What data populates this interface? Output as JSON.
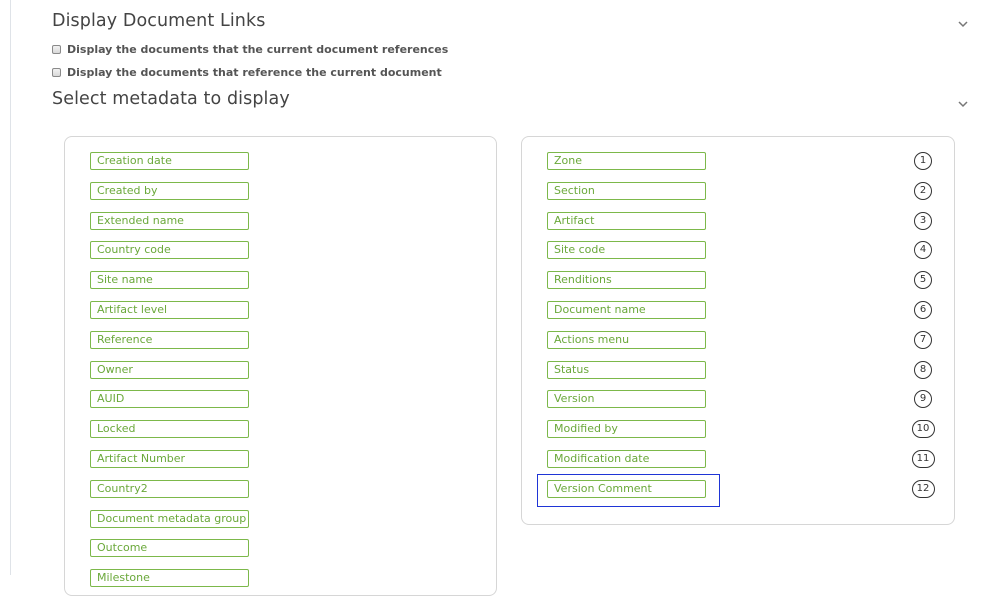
{
  "sections": {
    "links_title": "Display Document Links",
    "metadata_title": "Select metadata to display"
  },
  "checkboxes": [
    {
      "label": "Display the documents that the current document references",
      "checked": false
    },
    {
      "label": "Display the documents that reference the current document",
      "checked": false
    }
  ],
  "available_fields": [
    "Creation date",
    "Created by",
    "Extended name",
    "Country code",
    "Site name",
    "Artifact level",
    "Reference",
    "Owner",
    "AUID",
    "Locked",
    "Artifact Number",
    "Country2",
    "Document metadata group",
    "Outcome",
    "Milestone"
  ],
  "selected_fields": [
    {
      "label": "Zone",
      "order": "1"
    },
    {
      "label": "Section",
      "order": "2"
    },
    {
      "label": "Artifact",
      "order": "3"
    },
    {
      "label": "Site code",
      "order": "4"
    },
    {
      "label": "Renditions",
      "order": "5"
    },
    {
      "label": "Document name",
      "order": "6"
    },
    {
      "label": "Actions menu",
      "order": "7"
    },
    {
      "label": "Status",
      "order": "8"
    },
    {
      "label": "Version",
      "order": "9"
    },
    {
      "label": "Modified by",
      "order": "10"
    },
    {
      "label": "Modification date",
      "order": "11"
    },
    {
      "label": "Version Comment",
      "order": "12"
    }
  ],
  "colors": {
    "tag_border": "#7cb84a",
    "tag_text": "#6aa83a",
    "highlight": "#1f35d6"
  },
  "icons": {
    "collapse": "chevron-down-icon"
  }
}
